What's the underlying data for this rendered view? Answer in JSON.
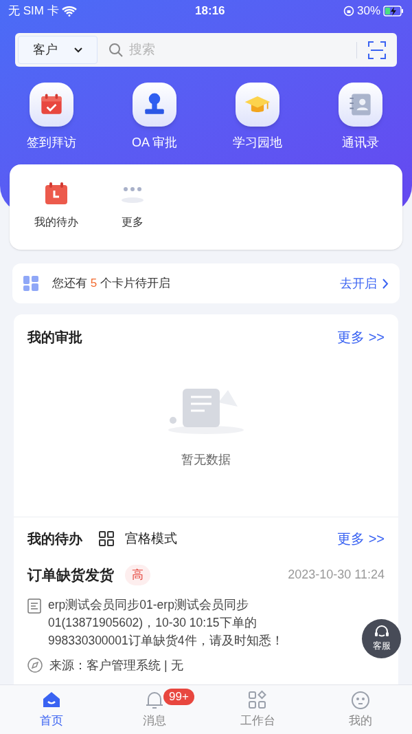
{
  "status_bar": {
    "carrier": "无 SIM 卡",
    "time": "18:16",
    "battery": "30%"
  },
  "search": {
    "scope": "客户",
    "placeholder": "搜索"
  },
  "shortcuts": [
    {
      "kind": "calendar",
      "label": "签到拜访"
    },
    {
      "kind": "stamp",
      "label": "OA 审批"
    },
    {
      "kind": "cap",
      "label": "学习园地"
    },
    {
      "kind": "contacts",
      "label": "通讯录"
    }
  ],
  "quick_apps": [
    {
      "kind": "todo",
      "label": "我的待办"
    },
    {
      "kind": "more",
      "label": "更多"
    }
  ],
  "cards_banner": {
    "before": "您还有",
    "count": "5",
    "after": "个卡片待开启",
    "action": "去开启"
  },
  "approvals": {
    "title": "我的审批",
    "more": "更多 >>",
    "empty": "暂无数据"
  },
  "todos": {
    "title": "我的待办",
    "mode": "宫格模式",
    "more": "更多 >>",
    "items": [
      {
        "title": "订单缺货发货",
        "priority": "高",
        "time": "2023-10-30 11:24",
        "content": "erp测试会员同步01-erp测试会员同步01(13871905602)，10-30 10:15下单的998330300001订单缺货4件，请及时知悉！",
        "source": "来源：客户管理系统 | 无"
      }
    ]
  },
  "support_button": "客服",
  "tab_bar": [
    {
      "kind": "home",
      "label": "首页",
      "selected": true
    },
    {
      "kind": "bell",
      "label": "消息",
      "selected": false,
      "badge": "99+"
    },
    {
      "kind": "grid",
      "label": "工作台",
      "selected": false
    },
    {
      "kind": "face",
      "label": "我的",
      "selected": false
    }
  ]
}
